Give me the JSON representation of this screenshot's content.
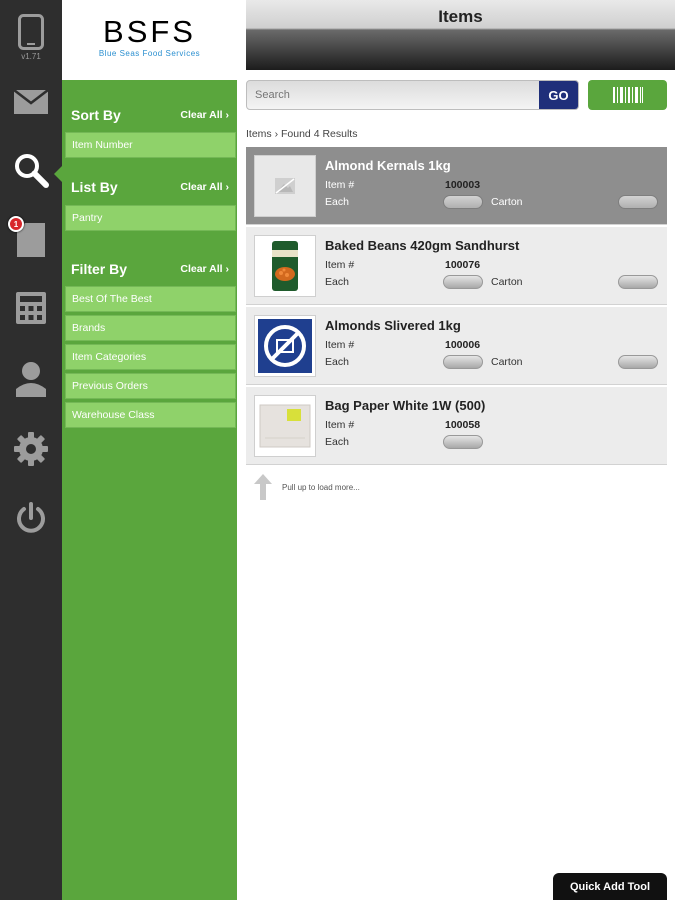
{
  "app": {
    "version": "v1.71",
    "logo_text": "BSFS",
    "logo_sub": "Blue Seas Food Services",
    "badge_count": "1"
  },
  "header": {
    "title": "Items"
  },
  "search": {
    "placeholder": "Search",
    "value": "",
    "go_label": "GO"
  },
  "breadcrumb": "Items › Found 4 Results",
  "sidebar": {
    "sort": {
      "title": "Sort By",
      "clear": "Clear All ›",
      "options": [
        "Item Number"
      ]
    },
    "list": {
      "title": "List By",
      "clear": "Clear All ›",
      "options": [
        "Pantry"
      ]
    },
    "filter": {
      "title": "Filter By",
      "clear": "Clear All ›",
      "options": [
        "Best Of The Best",
        "Brands",
        "Item Categories",
        "Previous Orders",
        "Warehouse Class"
      ]
    }
  },
  "labels": {
    "item_no": "Item #",
    "each": "Each",
    "carton": "Carton"
  },
  "items": [
    {
      "name": "Almond Kernals 1kg",
      "number": "100003"
    },
    {
      "name": "Baked Beans 420gm Sandhurst",
      "number": "100076"
    },
    {
      "name": "Almonds Slivered 1kg",
      "number": "100006"
    },
    {
      "name": "Bag Paper White 1W (500)",
      "number": "100058"
    }
  ],
  "pull_text": "Pull up to load more...",
  "quick_add": "Quick Add Tool",
  "colors": {
    "rail": "#2e2e2e",
    "green": "#5aa63d",
    "go": "#1f2f7a"
  }
}
